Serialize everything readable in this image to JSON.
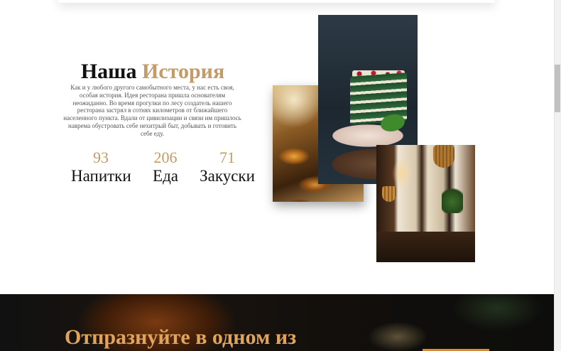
{
  "story": {
    "title_main": "Наша",
    "title_accent": "История",
    "text": "Как и у любого другого самобытного места, у нас есть своя, особая история. Идея ресторана пришла основателям неожиданно. Во время прогулки по лесу создатель нашего ресторана застрял в сотнях километров от ближайшего населенного пункта. Вдали от цивилизации и связи им пришлось наврема обустровать себе нехитрый быт, добывать и готовить себе еду."
  },
  "stats": [
    {
      "number": "93",
      "label": "Напитки"
    },
    {
      "number": "206",
      "label": "Еда"
    },
    {
      "number": "71",
      "label": "Закуски"
    }
  ],
  "celebrate": {
    "heading": "Отпразнуйте в одном из"
  },
  "colors": {
    "accent": "#c49a66",
    "heading_on_dark": "#e0a45c",
    "text": "#111111"
  }
}
